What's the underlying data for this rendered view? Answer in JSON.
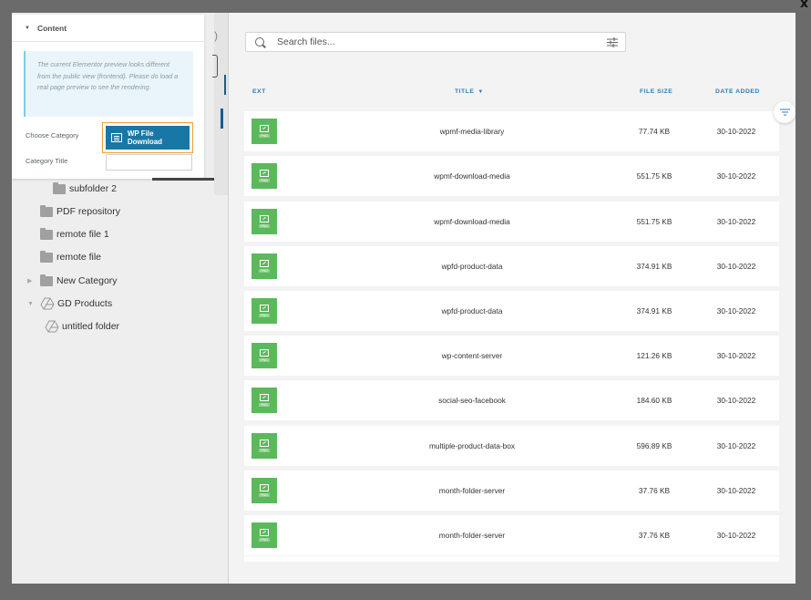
{
  "modal": {
    "close_label": "x"
  },
  "elementor_panel": {
    "section_title": "Content",
    "notice": "The current Elementor preview looks different from the public view (frontend). Please do load a real page preview to see the rendering.",
    "choose_category_label": "Choose Category",
    "choose_category_button": "WP File Download",
    "category_title_label": "Category Title",
    "category_title_value": ""
  },
  "tree": {
    "items": [
      {
        "label": "subfolder 2",
        "icon": "folder-icon"
      },
      {
        "label": "PDF repository",
        "icon": "folder-icon"
      },
      {
        "label": "remote file 1",
        "icon": "folder-icon"
      },
      {
        "label": "remote file",
        "icon": "folder-icon"
      },
      {
        "label": "New Category",
        "icon": "folder-icon"
      },
      {
        "label": "GD Products",
        "icon": "google-drive-icon"
      },
      {
        "label": "untitled folder",
        "icon": "google-drive-icon"
      }
    ]
  },
  "files": {
    "search_placeholder": "Search files...",
    "columns": {
      "ext": "EXT",
      "title": "TITLE",
      "size": "FILE SIZE",
      "date": "DATE ADDED"
    },
    "accent": "#2e7db0",
    "ext_color": "#5cb85c",
    "rows": [
      {
        "ext": "PNG",
        "title": "wpmf-media-library",
        "size": "77.74 KB",
        "date": "30-10-2022"
      },
      {
        "ext": "PNG",
        "title": "wpmf-download-media",
        "size": "551.75 KB",
        "date": "30-10-2022"
      },
      {
        "ext": "PNG",
        "title": "wpmf-download-media",
        "size": "551.75 KB",
        "date": "30-10-2022"
      },
      {
        "ext": "PNG",
        "title": "wpfd-product-data",
        "size": "374.91 KB",
        "date": "30-10-2022"
      },
      {
        "ext": "PNG",
        "title": "wpfd-product-data",
        "size": "374.91 KB",
        "date": "30-10-2022"
      },
      {
        "ext": "PNG",
        "title": "wp-content-server",
        "size": "121.26 KB",
        "date": "30-10-2022"
      },
      {
        "ext": "PNG",
        "title": "social-seo-facebook",
        "size": "184.60 KB",
        "date": "30-10-2022"
      },
      {
        "ext": "PNG",
        "title": "multiple-product-data-box",
        "size": "596.89 KB",
        "date": "30-10-2022"
      },
      {
        "ext": "PNG",
        "title": "month-folder-server",
        "size": "37.76 KB",
        "date": "30-10-2022"
      },
      {
        "ext": "PNG",
        "title": "month-folder-server",
        "size": "37.76 KB",
        "date": "30-10-2022"
      }
    ]
  }
}
